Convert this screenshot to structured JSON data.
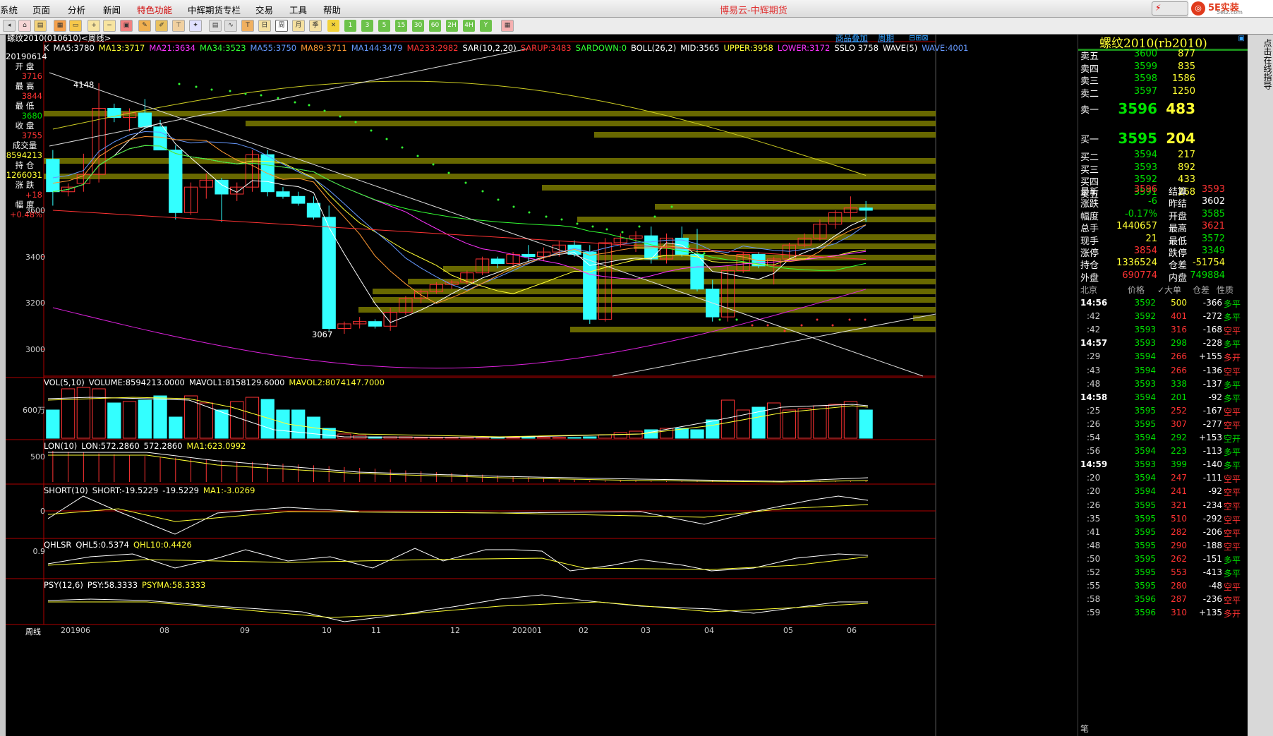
{
  "app": {
    "title": "博易云-中辉期货",
    "logo_text": "5E实装",
    "logo_sub": "5etz.com"
  },
  "menu": [
    "系统",
    "页面",
    "分析",
    "新闻",
    "特色功能",
    "中辉期货专栏",
    "交易",
    "工具",
    "帮助"
  ],
  "toolbar": {
    "periods": [
      "1",
      "3",
      "5",
      "15",
      "30",
      "60",
      "2H",
      "4H",
      "Y"
    ]
  },
  "chart": {
    "symbol_label": "螺纹2010(010610)<周线>",
    "right_links": [
      "商品叠加",
      "周期"
    ],
    "main_indicators": [
      {
        "text": "K",
        "color": "#ffffff"
      },
      {
        "text": "MA5:3780",
        "color": "#ffffff"
      },
      {
        "text": "MA13:3717",
        "color": "#ffff33"
      },
      {
        "text": "MA21:3634",
        "color": "#ff33ff"
      },
      {
        "text": "MA34:3523",
        "color": "#33ff33"
      },
      {
        "text": "MA55:3750",
        "color": "#6699ff"
      },
      {
        "text": "MA89:3711",
        "color": "#ff9933"
      },
      {
        "text": "MA144:3479",
        "color": "#6699ff"
      },
      {
        "text": "MA233:2982",
        "color": "#ff3333"
      },
      {
        "text": "SAR(10,2,20)",
        "color": "#ffffff"
      },
      {
        "text": "SARUP:3483",
        "color": "#ff3333"
      },
      {
        "text": "SARDOWN:0",
        "color": "#33ff33"
      },
      {
        "text": "BOLL(26,2)",
        "color": "#ffffff"
      },
      {
        "text": "MID:3565",
        "color": "#ffffff"
      },
      {
        "text": "UPPER:3958",
        "color": "#ffff33"
      },
      {
        "text": "LOWER:3172",
        "color": "#ff33ff"
      },
      {
        "text": "SSLO 3758",
        "color": "#ffffff"
      },
      {
        "text": "WAVE(5)",
        "color": "#ffffff"
      },
      {
        "text": "WAVE:4001",
        "color": "#6699ff"
      }
    ],
    "price_axis": [
      "3600",
      "3400",
      "3200",
      "3000"
    ],
    "annotations": {
      "high": "4148",
      "low": "3067"
    },
    "vol_header": [
      {
        "text": "VOL(5,10)",
        "color": "#ffffff"
      },
      {
        "text": "VOLUME:8594213.0000",
        "color": "#ffffff"
      },
      {
        "text": "MAVOL1:8158129.6000",
        "color": "#ffffff"
      },
      {
        "text": "MAVOL2:8074147.7000",
        "color": "#ffff33"
      }
    ],
    "vol_axis": "600万",
    "lon_header": [
      {
        "text": "LON(10)",
        "color": "#ffffff"
      },
      {
        "text": "LON:572.2860",
        "color": "#ffffff"
      },
      {
        "text": "572.2860",
        "color": "#ffffff"
      },
      {
        "text": "MA1:623.0992",
        "color": "#ffff33"
      }
    ],
    "lon_axis": "500",
    "short_header": [
      {
        "text": "SHORT(10)",
        "color": "#ffffff"
      },
      {
        "text": "SHORT:-19.5229",
        "color": "#ffffff"
      },
      {
        "text": "-19.5229",
        "color": "#ffffff"
      },
      {
        "text": "MA1:-3.0269",
        "color": "#ffff33"
      }
    ],
    "short_axis": "0",
    "qhlsr_header": [
      {
        "text": "QHLSR",
        "color": "#ffffff"
      },
      {
        "text": "QHL5:0.5374",
        "color": "#ffffff"
      },
      {
        "text": "QHL10:0.4426",
        "color": "#ffff33"
      }
    ],
    "qhlsr_axis": "0.9",
    "psy_header": [
      {
        "text": "PSY(12,6)",
        "color": "#ffffff"
      },
      {
        "text": "PSY:58.3333",
        "color": "#ffffff"
      },
      {
        "text": "PSYMA:58.3333",
        "color": "#ffff33"
      }
    ],
    "x_axis": [
      "周线",
      "201906",
      "08",
      "09",
      "10",
      "11",
      "12",
      "202001",
      "02",
      "03",
      "04",
      "05",
      "06"
    ]
  },
  "left_info": [
    {
      "k": "20190614",
      "v": "",
      "c": "#ffffff"
    },
    {
      "k": "开 盘",
      "v": "3716",
      "c": "#ff3333"
    },
    {
      "k": "最 高",
      "v": "3844",
      "c": "#ff3333"
    },
    {
      "k": "最 低",
      "v": "3680",
      "c": "#00e000"
    },
    {
      "k": "收 盘",
      "v": "3755",
      "c": "#ff3333"
    },
    {
      "k": "成交量",
      "v": "8594213",
      "c": "#ffff33"
    },
    {
      "k": "持 仓",
      "v": "1266031",
      "c": "#ffff33"
    },
    {
      "k": "涨 跌",
      "v": "+18",
      "c": "#ff3333"
    },
    {
      "k": "幅 度",
      "v": "+0.48%",
      "c": "#ff3333"
    }
  ],
  "quote": {
    "title": "螺纹2010(rb2010)",
    "asks": [
      {
        "l": "卖五",
        "p": "3600",
        "v": "877"
      },
      {
        "l": "卖四",
        "p": "3599",
        "v": "835"
      },
      {
        "l": "卖三",
        "p": "3598",
        "v": "1586"
      },
      {
        "l": "卖二",
        "p": "3597",
        "v": "1250"
      },
      {
        "l": "卖一",
        "p": "3596",
        "v": "483"
      }
    ],
    "bids": [
      {
        "l": "买一",
        "p": "3595",
        "v": "204"
      },
      {
        "l": "买二",
        "p": "3594",
        "v": "217"
      },
      {
        "l": "买三",
        "p": "3593",
        "v": "892"
      },
      {
        "l": "买四",
        "p": "3592",
        "v": "433"
      },
      {
        "l": "买五",
        "p": "3591",
        "v": "268"
      }
    ],
    "stats": [
      {
        "l1": "最新",
        "v1": "3596",
        "c1": "#ff3333",
        "l2": "结算",
        "v2": "3593",
        "c2": "#ff3333"
      },
      {
        "l1": "涨跌",
        "v1": "-6",
        "c1": "#00e000",
        "l2": "昨结",
        "v2": "3602",
        "c2": "#ffffff"
      },
      {
        "l1": "幅度",
        "v1": "-0.17%",
        "c1": "#00e000",
        "l2": "开盘",
        "v2": "3585",
        "c2": "#00e000"
      },
      {
        "l1": "总手",
        "v1": "1440657",
        "c1": "#ffff33",
        "l2": "最高",
        "v2": "3621",
        "c2": "#ff3333"
      },
      {
        "l1": "现手",
        "v1": "21",
        "c1": "#ffff33",
        "l2": "最低",
        "v2": "3572",
        "c2": "#00e000"
      },
      {
        "l1": "涨停",
        "v1": "3854",
        "c1": "#ff3333",
        "l2": "跌停",
        "v2": "3349",
        "c2": "#00e000"
      },
      {
        "l1": "持仓",
        "v1": "1336524",
        "c1": "#ffff33",
        "l2": "仓差",
        "v2": "-51754",
        "c2": "#ffff33"
      },
      {
        "l1": "外盘",
        "v1": "690774",
        "c1": "#ff3333",
        "l2": "内盘",
        "v2": "749884",
        "c2": "#00e000"
      }
    ],
    "tick_header": [
      "北京",
      "价格",
      "✓大单",
      "仓差",
      "性质"
    ],
    "ticks": [
      {
        "t": "14:56",
        "p": "3592",
        "v": "500",
        "d": "-366",
        "n": "多平",
        "nc": "#00e000",
        "vc": "#ffff33"
      },
      {
        "t": ":42",
        "p": "3592",
        "v": "401",
        "d": "-272",
        "n": "多平",
        "nc": "#00e000",
        "vc": "#ff3333"
      },
      {
        "t": ":42",
        "p": "3593",
        "v": "316",
        "d": "-168",
        "n": "空平",
        "nc": "#ff3333",
        "vc": "#ff3333"
      },
      {
        "t": "14:57",
        "p": "3593",
        "v": "298",
        "d": "-228",
        "n": "多平",
        "nc": "#00e000",
        "vc": "#00e000"
      },
      {
        "t": ":29",
        "p": "3594",
        "v": "266",
        "d": "+155",
        "n": "多开",
        "nc": "#ff3333",
        "vc": "#ff3333"
      },
      {
        "t": ":43",
        "p": "3594",
        "v": "266",
        "d": "-136",
        "n": "空平",
        "nc": "#ff3333",
        "vc": "#ff3333"
      },
      {
        "t": ":48",
        "p": "3593",
        "v": "338",
        "d": "-137",
        "n": "多平",
        "nc": "#00e000",
        "vc": "#00e000"
      },
      {
        "t": "14:58",
        "p": "3594",
        "v": "201",
        "d": "-92",
        "n": "多平",
        "nc": "#00e000",
        "vc": "#00e000"
      },
      {
        "t": ":25",
        "p": "3595",
        "v": "252",
        "d": "-167",
        "n": "空平",
        "nc": "#ff3333",
        "vc": "#ff3333"
      },
      {
        "t": ":26",
        "p": "3595",
        "v": "307",
        "d": "-277",
        "n": "空平",
        "nc": "#ff3333",
        "vc": "#ff3333"
      },
      {
        "t": ":54",
        "p": "3594",
        "v": "292",
        "d": "+153",
        "n": "空开",
        "nc": "#00e000",
        "vc": "#00e000"
      },
      {
        "t": ":56",
        "p": "3594",
        "v": "223",
        "d": "-113",
        "n": "多平",
        "nc": "#00e000",
        "vc": "#00e000"
      },
      {
        "t": "14:59",
        "p": "3593",
        "v": "399",
        "d": "-140",
        "n": "多平",
        "nc": "#00e000",
        "vc": "#00e000"
      },
      {
        "t": ":20",
        "p": "3594",
        "v": "247",
        "d": "-111",
        "n": "空平",
        "nc": "#ff3333",
        "vc": "#ff3333"
      },
      {
        "t": ":20",
        "p": "3594",
        "v": "241",
        "d": "-92",
        "n": "空平",
        "nc": "#ff3333",
        "vc": "#ff3333"
      },
      {
        "t": ":26",
        "p": "3595",
        "v": "321",
        "d": "-234",
        "n": "空平",
        "nc": "#ff3333",
        "vc": "#ff3333"
      },
      {
        "t": ":35",
        "p": "3595",
        "v": "510",
        "d": "-292",
        "n": "空平",
        "nc": "#ff3333",
        "vc": "#ff3333"
      },
      {
        "t": ":41",
        "p": "3595",
        "v": "282",
        "d": "-206",
        "n": "空平",
        "nc": "#ff3333",
        "vc": "#ff3333"
      },
      {
        "t": ":48",
        "p": "3595",
        "v": "290",
        "d": "-188",
        "n": "空平",
        "nc": "#ff3333",
        "vc": "#ff3333"
      },
      {
        "t": ":50",
        "p": "3595",
        "v": "262",
        "d": "-151",
        "n": "多平",
        "nc": "#00e000",
        "vc": "#ff3333"
      },
      {
        "t": ":52",
        "p": "3595",
        "v": "553",
        "d": "-413",
        "n": "多平",
        "nc": "#00e000",
        "vc": "#ff3333"
      },
      {
        "t": ":55",
        "p": "3595",
        "v": "280",
        "d": "-48",
        "n": "空平",
        "nc": "#ff3333",
        "vc": "#ff3333"
      },
      {
        "t": ":58",
        "p": "3596",
        "v": "287",
        "d": "-236",
        "n": "空平",
        "nc": "#ff3333",
        "vc": "#ff3333"
      },
      {
        "t": ":59",
        "p": "3596",
        "v": "310",
        "d": "+135",
        "n": "多开",
        "nc": "#ff3333",
        "vc": "#ff3333"
      }
    ],
    "footer": "笔",
    "side_tab": "点击在线指导"
  },
  "chart_data": {
    "type": "candlestick",
    "title": "螺纹2010(010610)<周线>",
    "periods": "weekly",
    "yticks": [
      3600,
      3400,
      3200,
      3000
    ],
    "candles": [
      [
        3820,
        3860,
        3620,
        3680
      ],
      [
        3680,
        3716,
        3660,
        3700
      ],
      [
        3716,
        3844,
        3680,
        3755
      ],
      [
        3755,
        4148,
        3720,
        4040
      ],
      [
        4040,
        4060,
        3980,
        4000
      ],
      [
        4000,
        4040,
        3940,
        4020
      ],
      [
        4020,
        4080,
        3950,
        3960
      ],
      [
        3960,
        3990,
        3870,
        3860
      ],
      [
        3860,
        3880,
        3560,
        3590
      ],
      [
        3590,
        3720,
        3580,
        3700
      ],
      [
        3700,
        3760,
        3650,
        3730
      ],
      [
        3730,
        3740,
        3550,
        3670
      ],
      [
        3670,
        3720,
        3640,
        3700
      ],
      [
        3700,
        3860,
        3680,
        3840
      ],
      [
        3840,
        3860,
        3660,
        3680
      ],
      [
        3680,
        3700,
        3650,
        3660
      ],
      [
        3660,
        3680,
        3620,
        3630
      ],
      [
        3630,
        3660,
        3560,
        3570
      ],
      [
        3570,
        3620,
        3080,
        3090
      ],
      [
        3090,
        3120,
        3067,
        3110
      ],
      [
        3110,
        3140,
        3090,
        3120
      ],
      [
        3120,
        3130,
        3090,
        3100
      ],
      [
        3100,
        3180,
        3080,
        3160
      ],
      [
        3160,
        3230,
        3150,
        3220
      ],
      [
        3220,
        3260,
        3200,
        3250
      ],
      [
        3250,
        3290,
        3240,
        3280
      ],
      [
        3280,
        3300,
        3260,
        3290
      ],
      [
        3290,
        3340,
        3280,
        3330
      ],
      [
        3330,
        3400,
        3320,
        3390
      ],
      [
        3390,
        3400,
        3350,
        3370
      ],
      [
        3370,
        3420,
        3360,
        3410
      ],
      [
        3410,
        3450,
        3380,
        3400
      ],
      [
        3400,
        3440,
        3380,
        3420
      ],
      [
        3420,
        3470,
        3400,
        3450
      ],
      [
        3450,
        3470,
        3400,
        3410
      ],
      [
        3420,
        3450,
        3110,
        3130
      ],
      [
        3130,
        3480,
        3120,
        3460
      ],
      [
        3460,
        3500,
        3440,
        3480
      ],
      [
        3480,
        3510,
        3420,
        3490
      ],
      [
        3490,
        3530,
        3370,
        3390
      ],
      [
        3390,
        3500,
        3370,
        3480
      ],
      [
        3480,
        3530,
        3400,
        3410
      ],
      [
        3410,
        3520,
        3250,
        3260
      ],
      [
        3260,
        3300,
        3120,
        3140
      ],
      [
        3140,
        3360,
        3120,
        3340
      ],
      [
        3340,
        3420,
        3330,
        3410
      ],
      [
        3410,
        3420,
        3350,
        3360
      ],
      [
        3360,
        3400,
        3280,
        3390
      ],
      [
        3390,
        3460,
        3380,
        3450
      ],
      [
        3450,
        3500,
        3440,
        3480
      ],
      [
        3480,
        3560,
        3470,
        3540
      ],
      [
        3540,
        3600,
        3520,
        3590
      ],
      [
        3590,
        3660,
        3560,
        3610
      ],
      [
        3610,
        3640,
        3550,
        3600
      ]
    ],
    "volume_scale_label": "600万"
  }
}
